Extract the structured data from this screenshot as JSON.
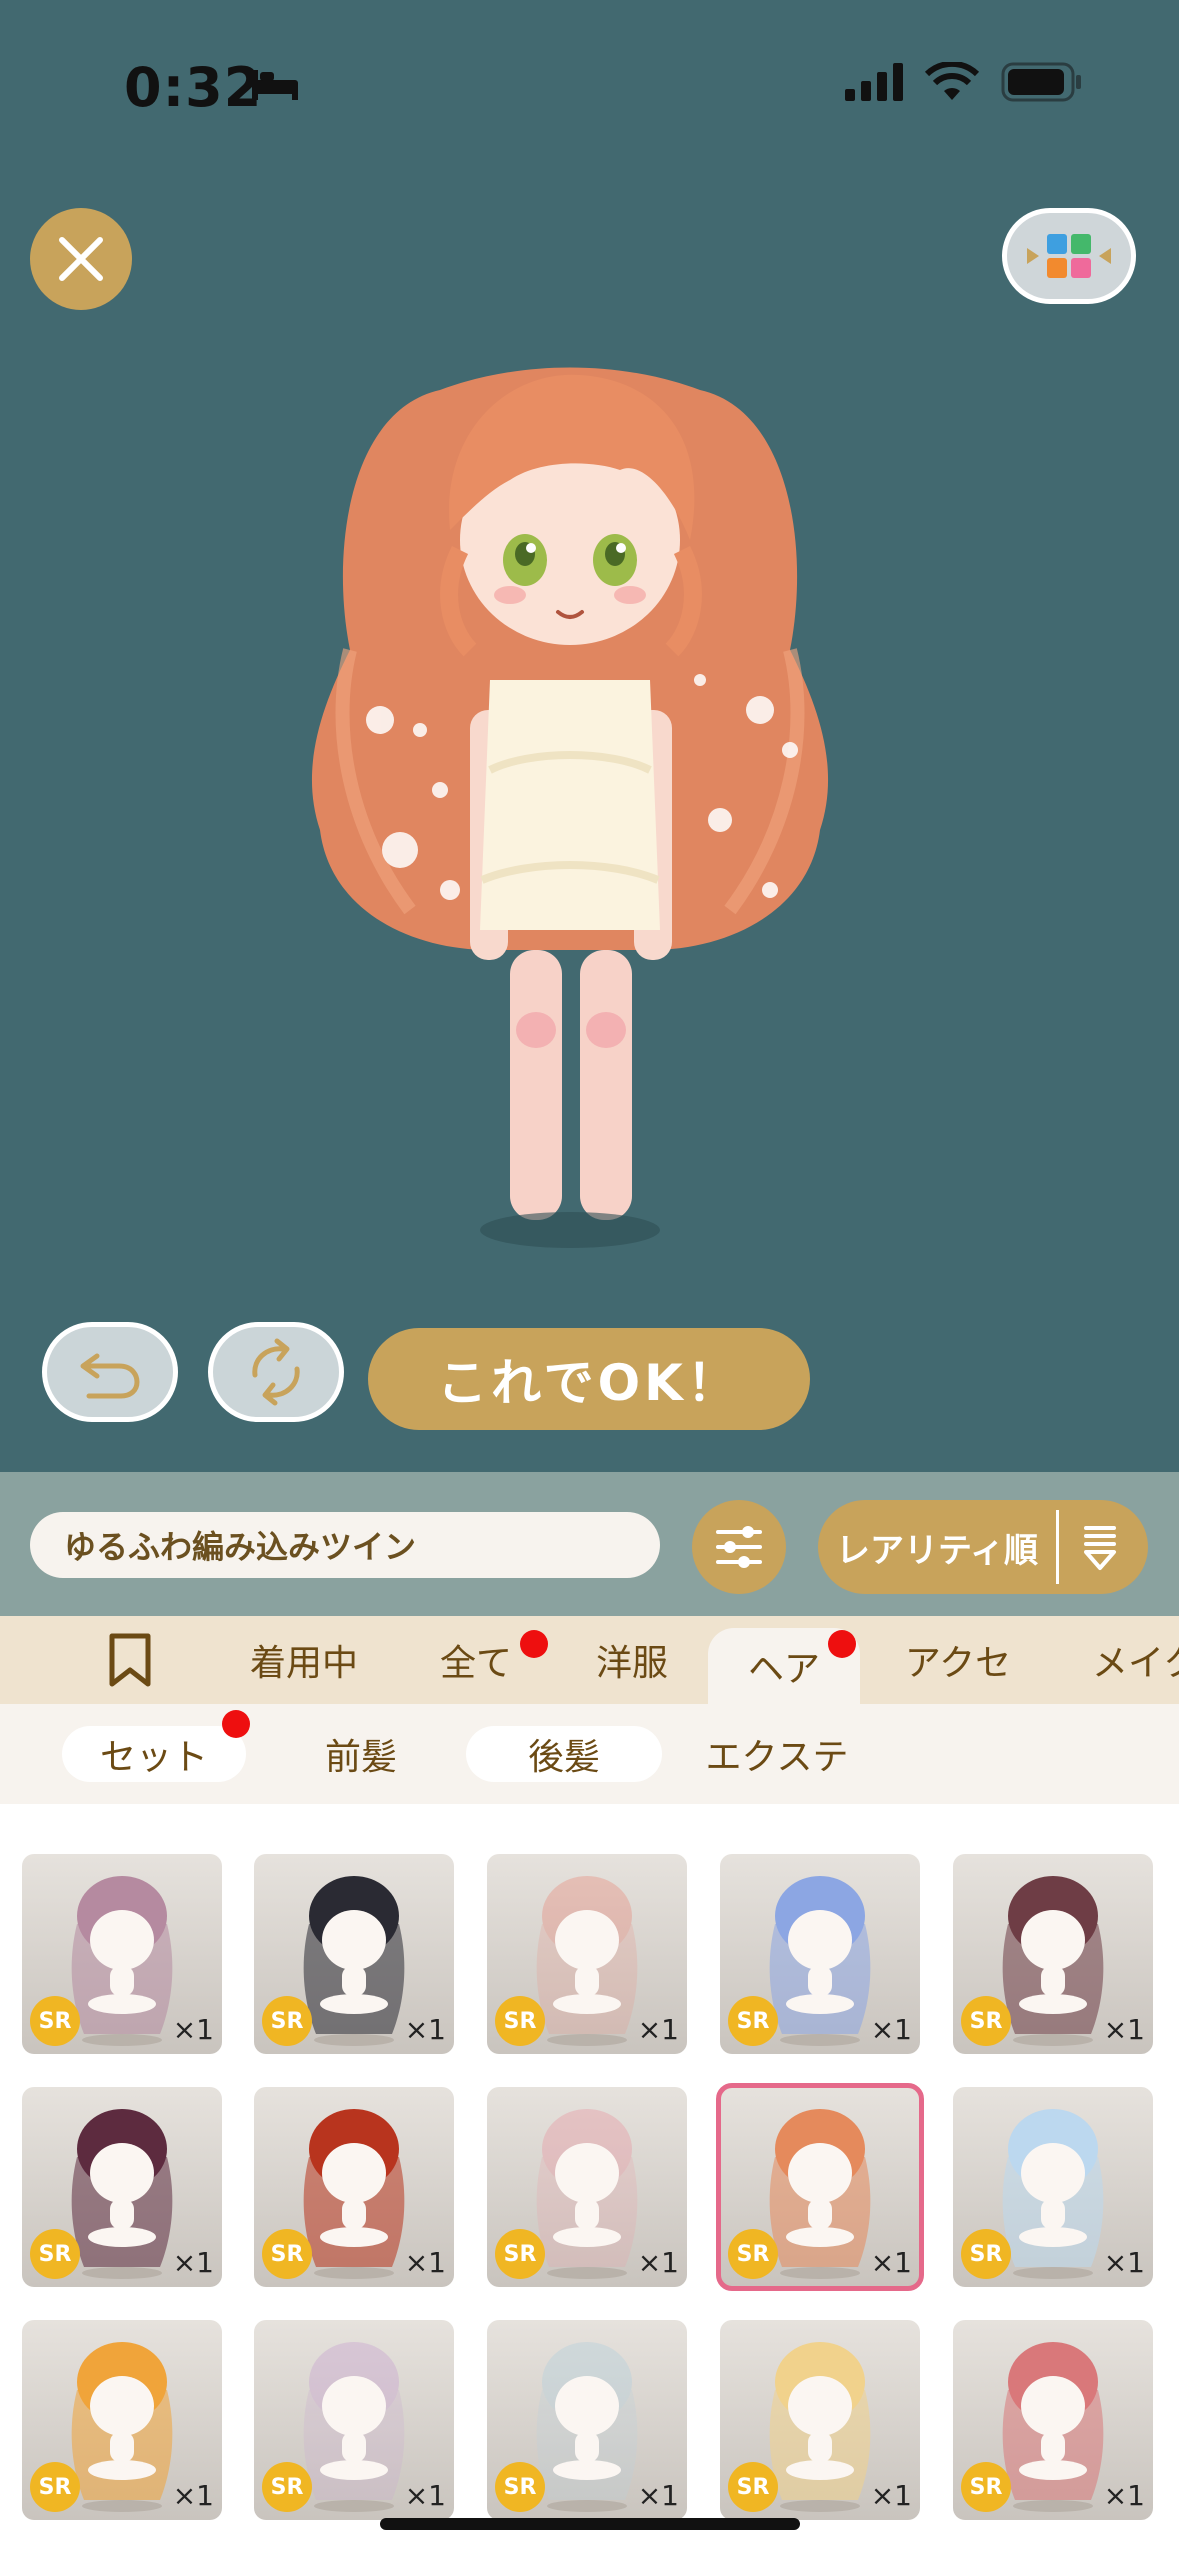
{
  "status": {
    "time": "0:32"
  },
  "stage": {
    "ok_label": "これでOK！"
  },
  "search": {
    "value": "ゆるふわ編み込みツイン"
  },
  "sort": {
    "label": "レアリティ順"
  },
  "tabs": [
    {
      "label": "着用中"
    },
    {
      "label": "全て",
      "badge": true
    },
    {
      "label": "洋服"
    },
    {
      "label": "ヘア",
      "badge": true,
      "active": true
    },
    {
      "label": "アクセ"
    },
    {
      "label": "メイク"
    }
  ],
  "subtabs": [
    {
      "label": "セット",
      "badge": true
    },
    {
      "label": "前髪",
      "active": true
    },
    {
      "label": "後髪"
    },
    {
      "label": "エクステ"
    }
  ],
  "items": [
    {
      "rarity": "SR",
      "count": "×1",
      "hair": "#b58aa0",
      "faded": false
    },
    {
      "rarity": "SR",
      "count": "×1",
      "hair": "#2a2a33",
      "faded": false
    },
    {
      "rarity": "SR",
      "count": "×1",
      "hair": "#e6968a",
      "faded": true
    },
    {
      "rarity": "SR",
      "count": "×1",
      "hair": "#8ca6e3",
      "faded": false
    },
    {
      "rarity": "SR",
      "count": "×1",
      "hair": "#6e3d45",
      "faded": false
    },
    {
      "rarity": "SR",
      "count": "×1",
      "hair": "#5d2b3f",
      "faded": false
    },
    {
      "rarity": "SR",
      "count": "×1",
      "hair": "#b8341e",
      "faded": false
    },
    {
      "rarity": "SR",
      "count": "×1",
      "hair": "#e7a0a8",
      "faded": true
    },
    {
      "rarity": "SR",
      "count": "×1",
      "hair": "#e58a5c",
      "faded": false,
      "selected": true
    },
    {
      "rarity": "SR",
      "count": "×1",
      "hair": "#bcd8ef",
      "faded": false
    },
    {
      "rarity": "SR",
      "count": "×1",
      "hair": "#f0a43a",
      "faded": false
    },
    {
      "rarity": "SR",
      "count": "×1",
      "hair": "#c9a8d0",
      "faded": true
    },
    {
      "rarity": "SR",
      "count": "×1",
      "hair": "#b8d0dc",
      "faded": true
    },
    {
      "rarity": "SR",
      "count": "×1",
      "hair": "#f1d28c",
      "faded": false
    },
    {
      "rarity": "SR",
      "count": "×1",
      "hair": "#d9787a",
      "faded": false
    }
  ]
}
